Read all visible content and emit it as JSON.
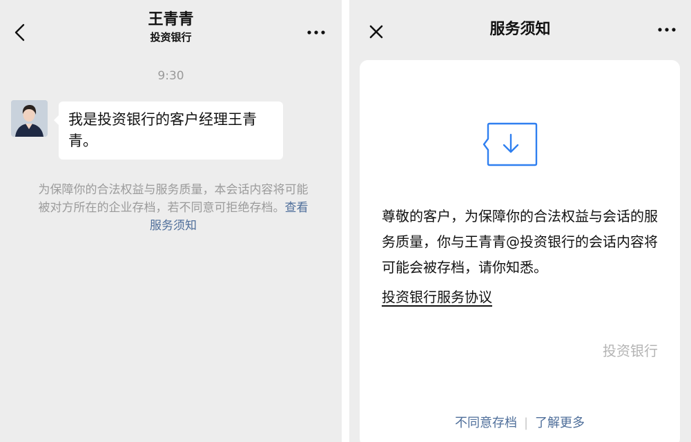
{
  "chat": {
    "contact_name": "王青青",
    "contact_org": "投资银行",
    "timestamp": "9:30",
    "message": "我是投资银行的客户经理王青青。",
    "notice_text": "为保障你的合法权益与服务质量，本会话内容将可能被对方所在的企业存档，若不同意可拒绝存档。",
    "notice_link": "查看服务须知"
  },
  "service_notice": {
    "title": "服务须知",
    "body": "尊敬的客户，为保障你的合法权益与会话的服务质量，你与王青青@投资银行的会话内容将可能会被存档，请你知悉。",
    "agreement_link": "投资银行服务协议",
    "signature": "投资银行",
    "footer": {
      "disagree": "不同意存档",
      "separator": "|",
      "learn_more": "了解更多"
    }
  },
  "icons": {
    "back": "back-chevron-icon",
    "more": "more-dots-icon",
    "close": "close-icon",
    "download": "download-archive-icon"
  },
  "colors": {
    "background": "#ededed",
    "link": "#4e6e9a",
    "accent_blue": "#2f7ff0"
  }
}
